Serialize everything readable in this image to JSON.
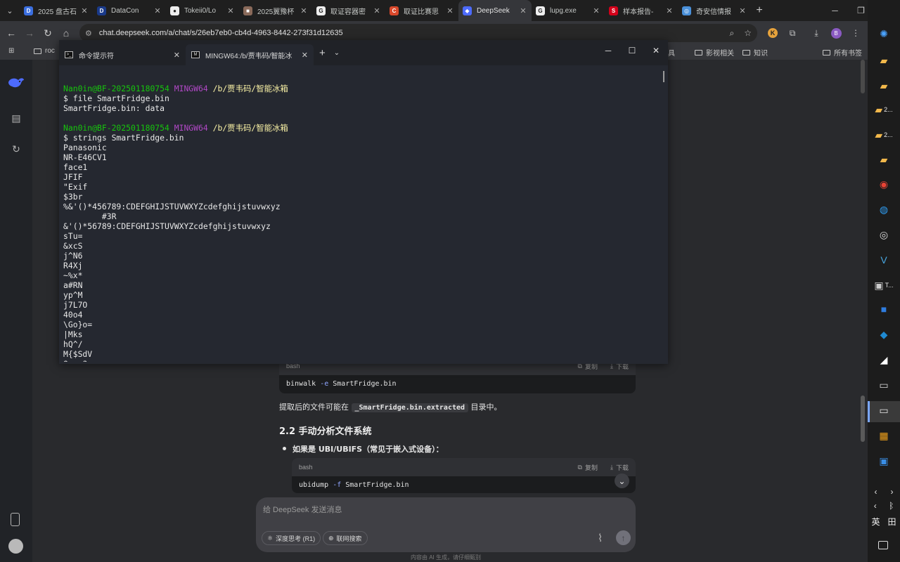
{
  "browser": {
    "tabs": [
      {
        "title": "2025 盘古石",
        "fav": "D",
        "color": "#3b6fe0"
      },
      {
        "title": "DataCon",
        "fav": "D",
        "color": "#1a3a8a"
      },
      {
        "title": "Tokeii0/Lo",
        "fav": "●",
        "color": "#eeeeee"
      },
      {
        "title": "2025翼豫杯",
        "fav": "■",
        "color": "#8a6a5a"
      },
      {
        "title": "取证容器密",
        "fav": "G",
        "color": "#eeeeee"
      },
      {
        "title": "取证比赛思",
        "fav": "C",
        "color": "#d9482b"
      },
      {
        "title": "DeepSeek",
        "fav": "◆",
        "color": "#4d6bfe"
      },
      {
        "title": "lupg.exe",
        "fav": "G",
        "color": "#eeeeee"
      },
      {
        "title": "样本报告-",
        "fav": "S",
        "color": "#d4001a"
      },
      {
        "title": "奇安信情报",
        "fav": "◎",
        "color": "#4a90d9"
      }
    ],
    "url": "chat.deepseek.com/a/chat/s/26eb7eb0-cb4d-4963-8442-273f31d12635",
    "profile_initial": "B",
    "bookmarks": [
      {
        "label": "roc"
      },
      {
        "label": "工具"
      },
      {
        "label": "影视相关"
      },
      {
        "label": "知识"
      },
      {
        "label": "所有书签"
      }
    ]
  },
  "terminal": {
    "tabs": [
      "命令提示符",
      "MINGW64:/b/贾韦码/智能冰箱"
    ],
    "prompt_user": "Nan0in@BF-202501180754",
    "prompt_env": "MINGW64",
    "prompt_path": "/b/贾韦码/智能冰箱",
    "cmd1": "$ file SmartFridge.bin",
    "out1": "SmartFridge.bin: data",
    "cmd2": "$ strings SmartFridge.bin",
    "strings_output": [
      "Panasonic",
      "NR-E46CV1",
      "face1",
      "JFIF",
      "\"Exif",
      "$3br",
      "%&'()*456789:CDEFGHIJSTUVWXYZcdefghijstuvwxyz",
      "        #3R",
      "&'()*56789:CDEFGHIJSTUVWXYZcdefghijstuvwxyz",
      "sTu=",
      "&xcS",
      "j^N6",
      "R4Xj",
      "~%x*",
      "a#RN",
      "yp^M",
      "j7L7O",
      "40o4",
      "\\Go}o=",
      "|Mks",
      "hQ^/",
      "M{$SdV",
      "O->y?y"
    ]
  },
  "deepseek": {
    "code1": {
      "lang": "bash",
      "copy": "复制",
      "download": "下载",
      "cmd": "binwalk",
      "flag": "-e",
      "arg": "SmartFridge.bin"
    },
    "para_pre": "提取后的文件可能在",
    "para_code": "_SmartFridge.bin.extracted",
    "para_post": "目录中。",
    "heading": "2.2 手动分析文件系统",
    "bullet": "如果是 UBI/UBIFS（常见于嵌入式设备）：",
    "code2": {
      "lang": "bash",
      "copy": "复制",
      "download": "下载",
      "cmd": "ubidump",
      "flag": "-f",
      "arg": "SmartFridge.bin"
    },
    "composer_placeholder": "给 DeepSeek 发送消息",
    "deep_think": "深度思考 (R1)",
    "web_search": "联网搜索",
    "disclaimer": "内容由 AI 生成，请仔细甄别"
  },
  "taskbar": {
    "items": [
      {
        "icon": "windows-logo",
        "label": ""
      },
      {
        "icon": "folder",
        "label": ""
      },
      {
        "icon": "folder",
        "label": ""
      },
      {
        "icon": "folder",
        "label": "2..."
      },
      {
        "icon": "folder",
        "label": "2..."
      },
      {
        "icon": "folder",
        "label": ""
      },
      {
        "icon": "chrome",
        "label": ""
      },
      {
        "icon": "edge",
        "label": ""
      },
      {
        "icon": "obs",
        "label": ""
      },
      {
        "icon": "app-v",
        "label": ""
      },
      {
        "icon": "terminal",
        "label": "T..."
      }
    ],
    "ime_lang": "英",
    "ime_grid": "田"
  },
  "colors": {
    "accent": "#4d6bfe",
    "prompt_user": "#16c60c",
    "prompt_env": "#b148c6",
    "prompt_path": "#f9f1a5"
  }
}
